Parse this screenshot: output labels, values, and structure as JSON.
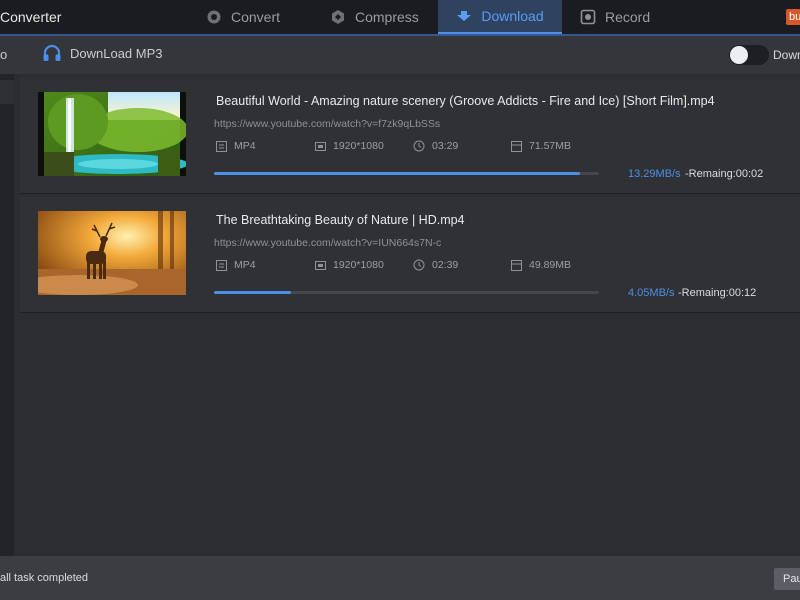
{
  "app": {
    "title": "Converter",
    "buy_badge": "bu"
  },
  "tabs": [
    {
      "label": "Convert",
      "icon": "convert-icon",
      "active": false
    },
    {
      "label": "Compress",
      "icon": "compress-icon",
      "active": false
    },
    {
      "label": "Download",
      "icon": "download-icon",
      "active": true
    },
    {
      "label": "Record",
      "icon": "record-icon",
      "active": false
    }
  ],
  "toolbar": {
    "left_fragment": "o",
    "download_mp3_label": "DownLoad MP3",
    "toggle_label": "Down",
    "toggle_on": false
  },
  "downloads": [
    {
      "title": "Beautiful World - Amazing nature scenery (Groove Addicts - Fire and Ice) [Short Film].mp4",
      "url": "https://www.youtube.com/watch?v=f7zk9qLbSSs",
      "format": "MP4",
      "resolution": "1920*1080",
      "duration": "03:29",
      "size": "71.57MB",
      "progress": 0.95,
      "speed": "13.29MB/s",
      "remaining": "-Remaing:00:02",
      "thumbnail": "waterfall-forest-image"
    },
    {
      "title": "The Breathtaking Beauty of Nature | HD.mp4",
      "url": "https://www.youtube.com/watch?v=IUN664s7N-c",
      "format": "MP4",
      "resolution": "1920*1080",
      "duration": "02:39",
      "size": "49.89MB",
      "progress": 0.2,
      "speed": "4.05MB/s",
      "remaining": "-Remaing:00:12",
      "thumbnail": "deer-sunset-image"
    }
  ],
  "footer": {
    "status": "all task completed",
    "pause_label": "Pau"
  },
  "colors": {
    "accent": "#4d8fe6",
    "background": "#2b2d31",
    "titlebar": "#1b1c1f",
    "badge": "#d8572a"
  }
}
